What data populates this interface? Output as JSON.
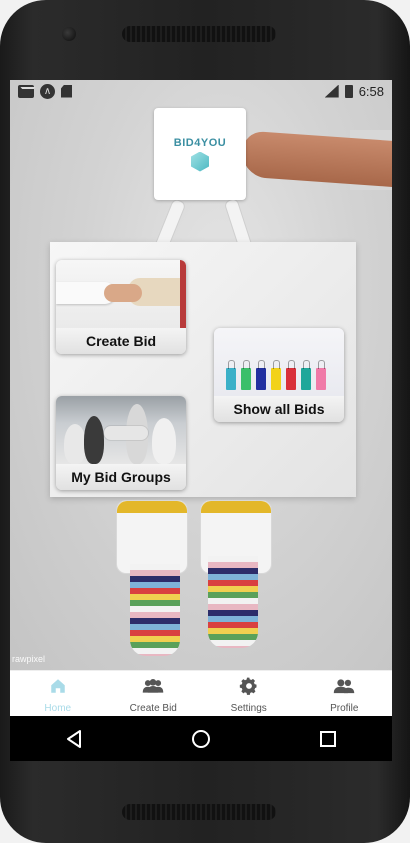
{
  "status_bar": {
    "time": "6:58",
    "network": "LTE",
    "left_icons": [
      "gmail-icon",
      "app-circle-icon",
      "sd-card-icon"
    ],
    "right_icons": [
      "signal-icon",
      "battery-icon"
    ]
  },
  "logo": {
    "text": "BID4YOU",
    "colors": {
      "text": "#3b8fa2",
      "hex": "#4bb9c2"
    }
  },
  "cards": {
    "create_bid": {
      "label": "Create Bid",
      "image": "handshake-image"
    },
    "show_all_bids": {
      "label": "Show all Bids",
      "image": "shopping-bags-image"
    },
    "my_bid_groups": {
      "label": "My Bid Groups",
      "image": "team-image"
    }
  },
  "watermark": "rawpixel",
  "bottom_nav": {
    "items": [
      {
        "label": "Home",
        "icon": "home-icon",
        "active": true
      },
      {
        "label": "Create Bid",
        "icon": "group-icon",
        "active": false
      },
      {
        "label": "Settings",
        "icon": "gear-icon",
        "active": false
      },
      {
        "label": "Profile",
        "icon": "people-icon",
        "active": false
      }
    ],
    "active_color": "#a9dbe8"
  },
  "system_nav": {
    "buttons": [
      "back-icon",
      "home-circle-icon",
      "recents-icon"
    ]
  }
}
